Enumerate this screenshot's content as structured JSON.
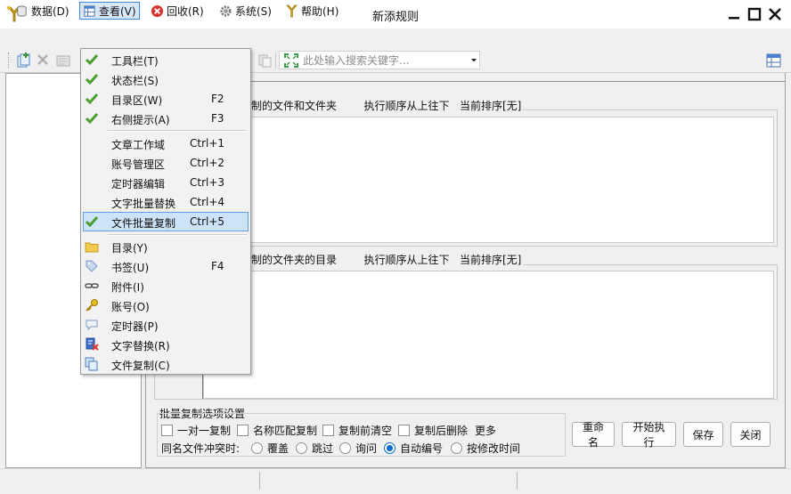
{
  "window": {
    "title": "新添规则"
  },
  "menubar": [
    {
      "label": "数据(D)",
      "icon": "database-icon"
    },
    {
      "label": "查看(V)",
      "icon": "grid-view-icon"
    },
    {
      "label": "回收(R)",
      "icon": "recycle-icon"
    },
    {
      "label": "系统(S)",
      "icon": "gear-icon"
    },
    {
      "label": "帮助(H)",
      "icon": "help-icon"
    }
  ],
  "toolbar": {
    "search_placeholder": "此处输入搜索关键字..."
  },
  "view_menu": {
    "items": [
      {
        "label": "工具栏(T)",
        "shortcut": "",
        "icon": "check-icon"
      },
      {
        "label": "状态栏(S)",
        "shortcut": "",
        "icon": "check-icon"
      },
      {
        "label": "目录区(W)",
        "shortcut": "F2",
        "icon": "check-icon"
      },
      {
        "label": "右侧提示(A)",
        "shortcut": "F3",
        "icon": "check-icon"
      },
      {
        "label": "文章工作域",
        "shortcut": "Ctrl+1",
        "icon": ""
      },
      {
        "label": "账号管理区",
        "shortcut": "Ctrl+2",
        "icon": ""
      },
      {
        "label": "定时器编辑",
        "shortcut": "Ctrl+3",
        "icon": ""
      },
      {
        "label": "文字批量替换",
        "shortcut": "Ctrl+4",
        "icon": ""
      },
      {
        "label": "文件批量复制",
        "shortcut": "Ctrl+5",
        "icon": "check-icon"
      },
      {
        "label": "目录(Y)",
        "shortcut": "",
        "icon": "folder-icon"
      },
      {
        "label": "书签(U)",
        "shortcut": "F4",
        "icon": "tag-icon"
      },
      {
        "label": "附件(I)",
        "shortcut": "",
        "icon": "link-icon"
      },
      {
        "label": "账号(O)",
        "shortcut": "",
        "icon": "key-icon"
      },
      {
        "label": "定时器(P)",
        "shortcut": "",
        "icon": "speech-bubble-icon"
      },
      {
        "label": "文字替换(R)",
        "shortcut": "",
        "icon": "text-replace-icon"
      },
      {
        "label": "文件复制(C)",
        "shortcut": "",
        "icon": "copy-icon"
      }
    ],
    "highlighted_index": 8
  },
  "right_panel": {
    "group1_label_visible": "制的文件和文件夹        执行顺序从上往下   当前排序[无]",
    "group2_label_visible": "制的文件夹的目录        执行顺序从上往下   当前排序[无]",
    "options_title": "批量复制选项设置",
    "checkboxes": [
      {
        "label": "一对一复制",
        "checked": false
      },
      {
        "label": "名称匹配复制",
        "checked": false
      },
      {
        "label": "复制前清空",
        "checked": false
      },
      {
        "label": "复制后删除",
        "checked": false
      }
    ],
    "more_label": "更多",
    "conflict_label": "同名文件冲突时:",
    "conflict_options": [
      {
        "label": "覆盖",
        "selected": false
      },
      {
        "label": "跳过",
        "selected": false
      },
      {
        "label": "询问",
        "selected": false
      },
      {
        "label": "自动编号",
        "selected": true
      },
      {
        "label": "按修改时间",
        "selected": false
      }
    ],
    "buttons": {
      "rename": "重命名",
      "start": "开始执行",
      "save": "保存",
      "close": "关闭"
    }
  },
  "colors": {
    "accent": "#0b6cd1",
    "menu_highlight": "#cde3f8",
    "check_green": "#4a9e2f"
  }
}
